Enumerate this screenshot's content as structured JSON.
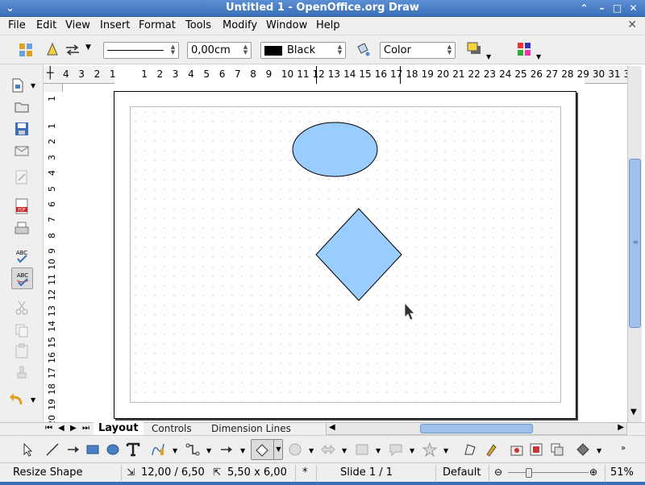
{
  "window": {
    "title": "Untitled 1 - OpenOffice.org Draw"
  },
  "menu": [
    "File",
    "Edit",
    "View",
    "Insert",
    "Format",
    "Tools",
    "Modify",
    "Window",
    "Help"
  ],
  "linebar": {
    "line_width": "0,00cm",
    "line_color": "Black",
    "area_style": "Color",
    "colors": {
      "line_swatch": "#000000"
    }
  },
  "hruler_numbers": [
    "4",
    "3",
    "2",
    "1",
    "1",
    "2",
    "3",
    "4",
    "5",
    "6",
    "7",
    "8",
    "9",
    "10",
    "11",
    "12",
    "13",
    "14",
    "15",
    "16",
    "17",
    "18",
    "19",
    "20",
    "21",
    "22",
    "23",
    "24",
    "25",
    "26",
    "27",
    "28",
    "29",
    "30",
    "31",
    "3"
  ],
  "vruler_numbers": [
    "1",
    "1",
    "2",
    "3",
    "4",
    "5",
    "6",
    "7",
    "8",
    "9",
    "10",
    "11",
    "12",
    "13",
    "14",
    "15",
    "16",
    "17",
    "18",
    "19",
    "20"
  ],
  "tabs": [
    "Layout",
    "Controls",
    "Dimension Lines"
  ],
  "status": {
    "action": "Resize Shape",
    "position": "12,00 / 6,50",
    "size": "5,50 x 6,00",
    "modified": "*",
    "slide": "Slide 1 / 1",
    "layout": "Default",
    "zoom": "51%",
    "zoom_percent": 51
  },
  "shapes": {
    "fill": "#99ccff",
    "stroke": "#000000",
    "ellipse": {
      "name": "ellipse"
    },
    "diamond": {
      "name": "diamond"
    }
  }
}
